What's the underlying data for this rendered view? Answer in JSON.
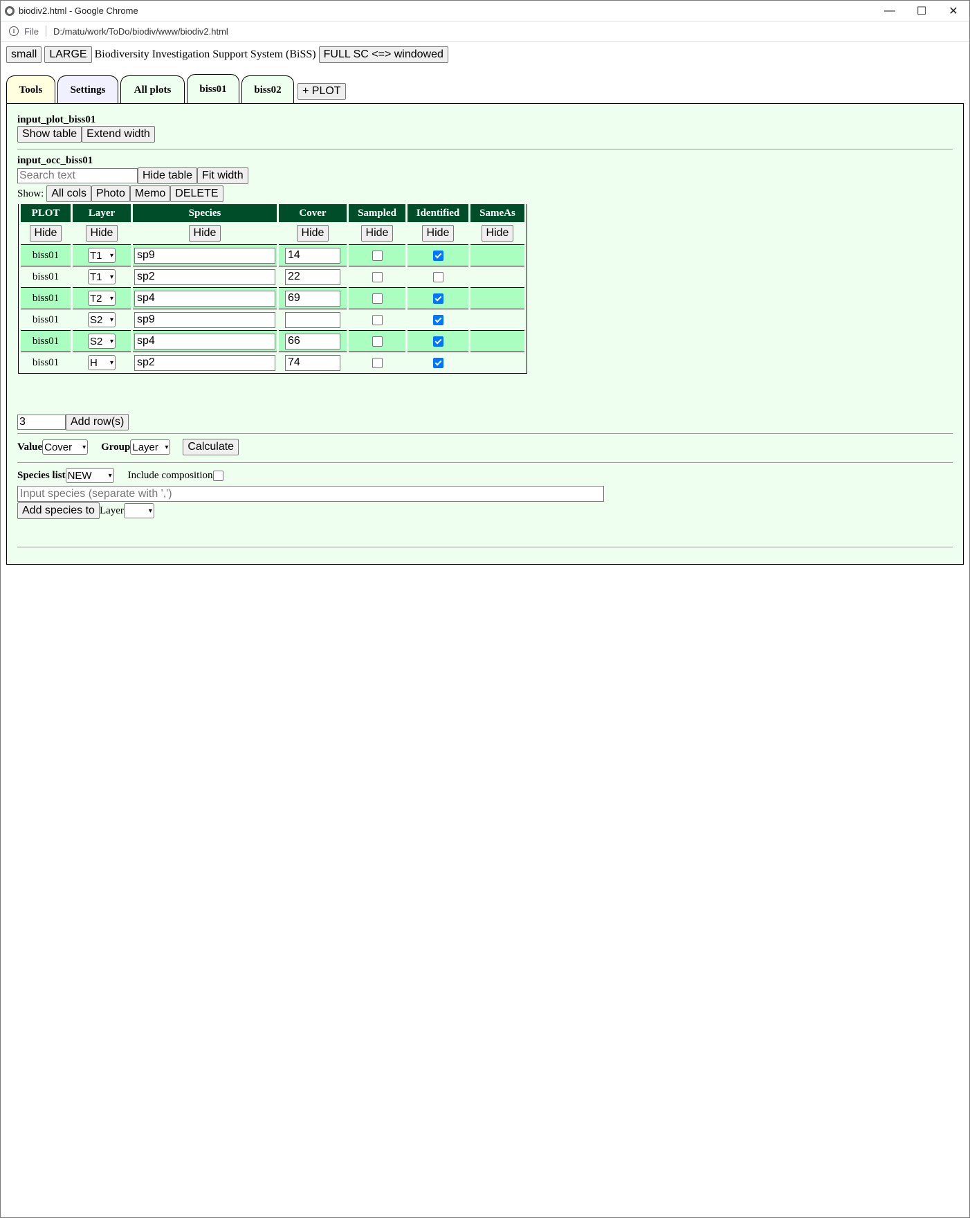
{
  "window": {
    "title": "biodiv2.html - Google Chrome",
    "minimize": "—",
    "maximize": "☐",
    "close": "✕"
  },
  "address": {
    "file_label": "File",
    "url": "D:/matu/work/ToDo/biodiv/www/biodiv2.html"
  },
  "topbar": {
    "small": "small",
    "large": "LARGE",
    "app_title": "Biodiversity Investigation Support System (BiSS)",
    "fullscreen": "FULL SC <=> windowed"
  },
  "tabs": {
    "tools": "Tools",
    "settings": "Settings",
    "all_plots": "All plots",
    "biss01": "biss01",
    "biss02": "biss02",
    "add_plot": "+ PLOT"
  },
  "plot_section": {
    "title": "input_plot_biss01",
    "show_table": "Show table",
    "extend_width": "Extend width"
  },
  "occ_section": {
    "title": "input_occ_biss01",
    "search_placeholder": "Search text",
    "hide_table": "Hide table",
    "fit_width": "Fit width",
    "show_label": "Show:",
    "all_cols": "All cols",
    "photo": "Photo",
    "memo": "Memo",
    "delete": "DELETE"
  },
  "table": {
    "columns": [
      "PLOT",
      "Layer",
      "Species",
      "Cover",
      "Sampled",
      "Identified",
      "SameAs"
    ],
    "hide_label": "Hide",
    "rows": [
      {
        "plot": "biss01",
        "layer": "T1",
        "species": "sp9",
        "cover": "14",
        "sampled": false,
        "identified": true
      },
      {
        "plot": "biss01",
        "layer": "T1",
        "species": "sp2",
        "cover": "22",
        "sampled": false,
        "identified": false
      },
      {
        "plot": "biss01",
        "layer": "T2",
        "species": "sp4",
        "cover": "69",
        "sampled": false,
        "identified": true
      },
      {
        "plot": "biss01",
        "layer": "S2",
        "species": "sp9",
        "cover": "",
        "sampled": false,
        "identified": true
      },
      {
        "plot": "biss01",
        "layer": "S2",
        "species": "sp4",
        "cover": "66",
        "sampled": false,
        "identified": true
      },
      {
        "plot": "biss01",
        "layer": "H",
        "species": "sp2",
        "cover": "74",
        "sampled": false,
        "identified": true
      }
    ]
  },
  "add_rows": {
    "count": "3",
    "button": "Add row(s)"
  },
  "calc": {
    "value_label": "Value",
    "value_selected": "Cover",
    "group_label": "Group",
    "group_selected": "Layer",
    "button": "Calculate"
  },
  "species_list": {
    "label": "Species list",
    "selected": "NEW",
    "include_label": "Include composition",
    "input_placeholder": "Input species (separate with ',')",
    "add_button": "Add species to",
    "layer_label": "Layer",
    "layer_selected": ""
  }
}
